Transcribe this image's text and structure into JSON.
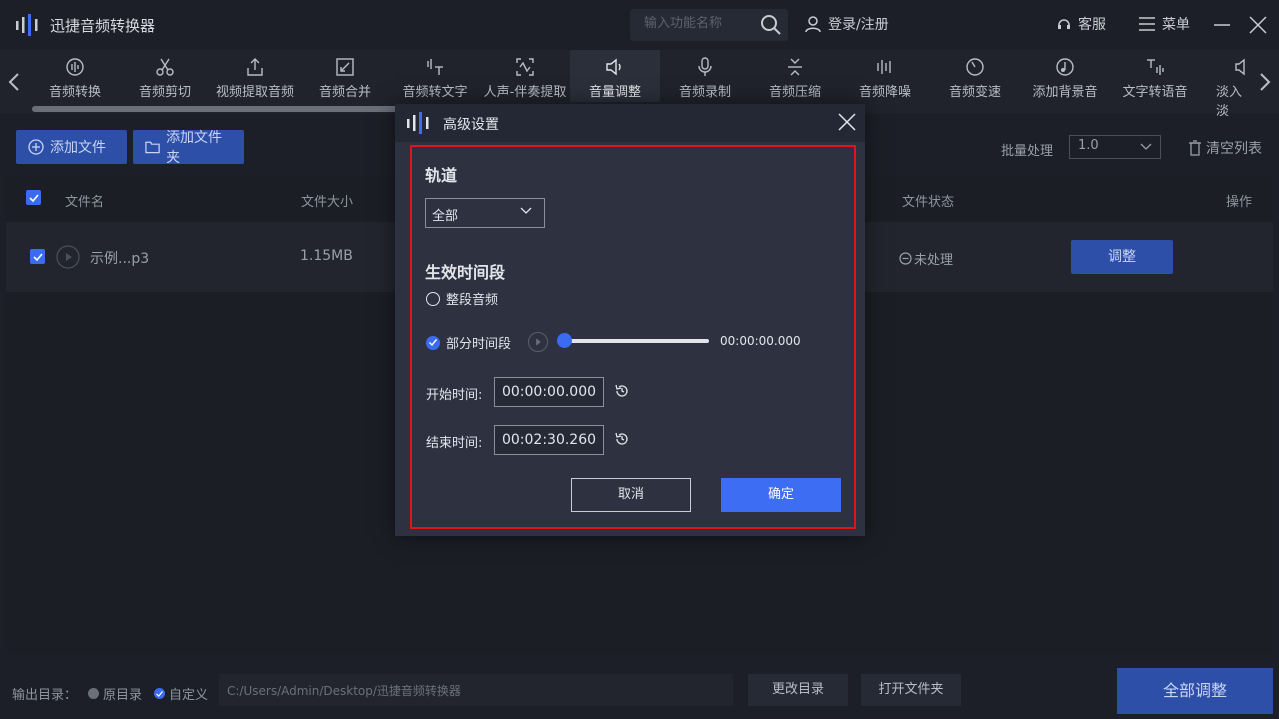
{
  "app": {
    "title": "迅捷音频转换器",
    "search_placeholder": "输入功能名称",
    "login": "登录/注册",
    "service": "客服",
    "menu": "菜单"
  },
  "tools": [
    {
      "label": "音频转换",
      "icon": "waveform-circle-icon"
    },
    {
      "label": "音频剪切",
      "icon": "scissors-icon"
    },
    {
      "label": "视频提取音频",
      "icon": "upload-icon"
    },
    {
      "label": "音频合并",
      "icon": "merge-icon"
    },
    {
      "label": "音频转文字",
      "icon": "text-convert-icon"
    },
    {
      "label": "人声-伴奏提取",
      "icon": "vocal-extract-icon"
    },
    {
      "label": "音量调整",
      "icon": "speaker-icon"
    },
    {
      "label": "音频录制",
      "icon": "microphone-icon"
    },
    {
      "label": "音频压缩",
      "icon": "compress-icon"
    },
    {
      "label": "音频降噪",
      "icon": "noise-reduce-icon"
    },
    {
      "label": "音频变速",
      "icon": "speed-icon"
    },
    {
      "label": "添加背景音",
      "icon": "music-note-icon"
    },
    {
      "label": "文字转语音",
      "icon": "text-to-speech-icon"
    },
    {
      "label": "淡入淡",
      "icon": "fade-icon"
    }
  ],
  "actions": {
    "add_file": "添加文件",
    "add_folder": "添加文件夹",
    "batch_label": "批量处理",
    "batch_value": "1.0",
    "clear_list": "清空列表"
  },
  "table": {
    "headers": {
      "name": "文件名",
      "size": "文件大小",
      "status": "文件状态",
      "action": "操作"
    },
    "rows": [
      {
        "name": "示例...p3",
        "size": "1.15MB",
        "status": "未处理",
        "action": "调整"
      }
    ]
  },
  "footer": {
    "output_label": "输出目录：",
    "opt_original": "原目录",
    "opt_custom": "自定义",
    "path": "C:/Users/Admin/Desktop/迅捷音频转换器",
    "change_dir": "更改目录",
    "open_folder": "打开文件夹",
    "adjust_all": "全部调整"
  },
  "dialog": {
    "title": "高级设置",
    "track_title": "轨道",
    "track_value": "全部",
    "range_title": "生效时间段",
    "opt_whole": "整段音频",
    "opt_partial": "部分时间段",
    "current_time": "00:00:00.000",
    "start_label": "开始时间:",
    "start_value": "00:00:00.000",
    "end_label": "结束时间:",
    "end_value": "00:02:30.260",
    "cancel": "取消",
    "confirm": "确定"
  },
  "colors": {
    "accent": "#3d6df2",
    "button_blue": "#2d4fa7",
    "highlight_border": "#e1141b"
  }
}
